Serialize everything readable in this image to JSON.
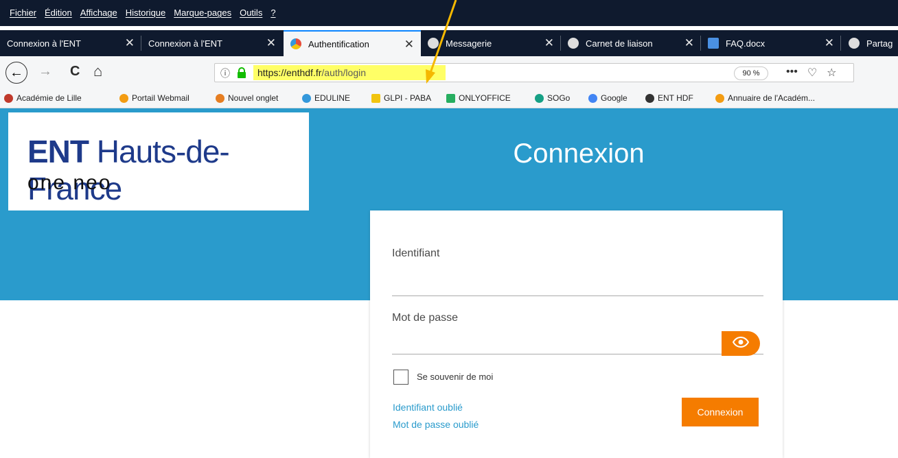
{
  "menubar": {
    "items": [
      "Fichier",
      "Édition",
      "Affichage",
      "Historique",
      "Marque-pages",
      "Outils",
      "?"
    ]
  },
  "tabs": [
    {
      "label": "Connexion à l'ENT",
      "active": false
    },
    {
      "label": "Connexion à l'ENT",
      "active": false
    },
    {
      "label": "Authentification",
      "active": true
    },
    {
      "label": "Messagerie",
      "active": false
    },
    {
      "label": "Carnet de liaison",
      "active": false
    },
    {
      "label": "FAQ.docx",
      "active": false
    },
    {
      "label": "Partag",
      "active": false
    }
  ],
  "navbar": {
    "url": "https://enthdf.fr/auth/login",
    "url_host": "https://enthdf.fr",
    "url_path": "/auth/login",
    "zoom": "90 %",
    "back_icon": "←",
    "forward_icon": "→",
    "reload_icon": "C",
    "home_icon": "⌂"
  },
  "bookmarks": [
    {
      "label": "Académie de Lille",
      "color": "#c0392b"
    },
    {
      "label": "Portail Webmail",
      "color": "#f39c12"
    },
    {
      "label": "Nouvel onglet",
      "color": "#e67e22"
    },
    {
      "label": "EDULINE",
      "color": "#3498db"
    },
    {
      "label": "GLPI - PABA",
      "color": "#f1c40f"
    },
    {
      "label": "ONLYOFFICE",
      "color": "#27ae60"
    },
    {
      "label": "SOGo",
      "color": "#16a085"
    },
    {
      "label": "Google",
      "color": "#4285f4"
    },
    {
      "label": "ENT HDF",
      "color": "#333333"
    },
    {
      "label": "Annuaire de l'Académ...",
      "color": "#f39c12"
    }
  ],
  "page": {
    "logo_ent": "ENT",
    "logo_region": "Hauts-de-France",
    "logo_sub": "one neo",
    "title": "Connexion"
  },
  "form": {
    "login_label": "Identifiant",
    "password_label": "Mot de passe",
    "login_value": "",
    "password_value": "",
    "remember_label": "Se souvenir de moi",
    "forgot_login": "Identifiant oublié",
    "forgot_password": "Mot de passe oublié",
    "submit_label": "Connexion"
  },
  "colors": {
    "hero": "#2a9bcc",
    "accent": "#f57c00",
    "highlight": "#ffff66",
    "annotation_arrow": "#f5b800"
  }
}
